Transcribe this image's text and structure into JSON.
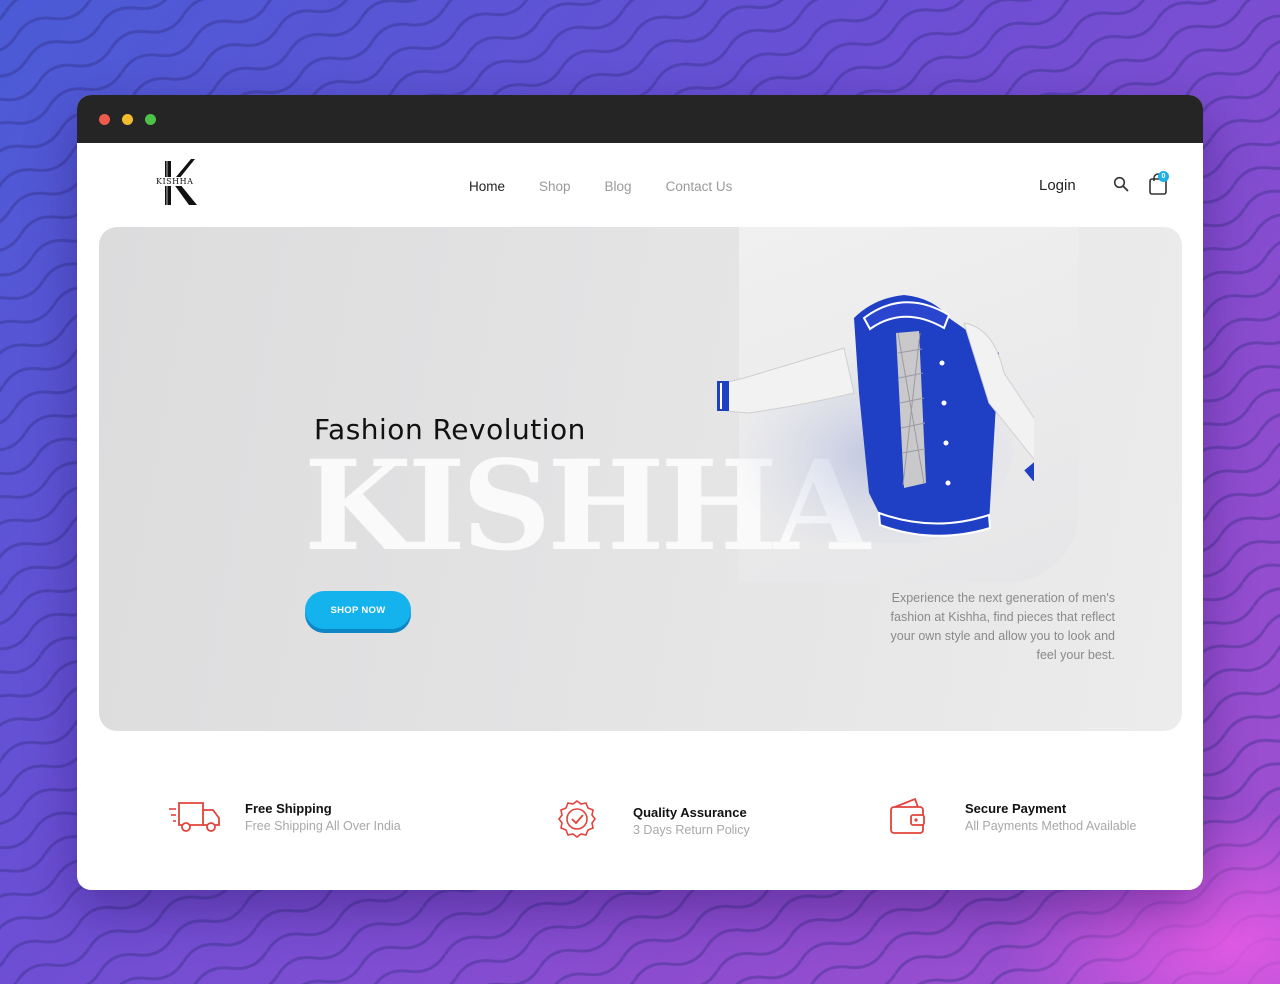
{
  "brand": {
    "logo_text": "KISHHA"
  },
  "nav": {
    "items": [
      {
        "label": "Home",
        "active": true
      },
      {
        "label": "Shop",
        "active": false
      },
      {
        "label": "Blog",
        "active": false
      },
      {
        "label": "Contact Us",
        "active": false
      }
    ],
    "login_label": "Login",
    "cart_count": "0"
  },
  "hero": {
    "subtitle": "Fashion Revolution",
    "big_title": "KISHHA",
    "cta_label": "SHOP NOW",
    "description": "Experience the next generation of men's fashion at Kishha, find pieces that reflect your own style and allow you to look and feel your best."
  },
  "features": [
    {
      "title": "Free Shipping",
      "desc": "Free Shipping All Over India",
      "icon": "truck-icon"
    },
    {
      "title": "Quality Assurance",
      "desc": "3 Days Return Policy",
      "icon": "quality-badge-icon"
    },
    {
      "title": "Secure Payment",
      "desc": "All Payments Method Available",
      "icon": "wallet-icon"
    }
  ],
  "colors": {
    "accent": "#15b3ee",
    "feature_icon": "#e0443c",
    "jacket_blue": "#1f3fc4"
  }
}
